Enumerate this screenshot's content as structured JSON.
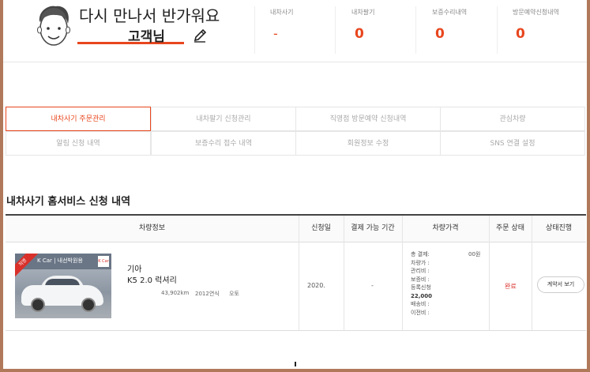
{
  "profile": {
    "greeting": "다시 만나서 반가워요",
    "customer_label": "고객님",
    "avatar_icon": "user-avatar-icon",
    "edit_icon": "pencil-icon"
  },
  "stats": [
    {
      "label": "내차사기",
      "value": "-"
    },
    {
      "label": "내차팔기",
      "value": "0"
    },
    {
      "label": "보증수리내역",
      "value": "0"
    },
    {
      "label": "방문예약신청내역",
      "value": "0"
    }
  ],
  "tabs": [
    {
      "label": "내차사기 주문관리",
      "active": true
    },
    {
      "label": "내차팔기 신청관리",
      "active": false
    },
    {
      "label": "직영점 방문예약 신청내역",
      "active": false
    },
    {
      "label": "관심차량",
      "active": false
    },
    {
      "label": "알림 신청 내역",
      "active": false
    },
    {
      "label": "보증수리 접수 내역",
      "active": false
    },
    {
      "label": "회원정보 수정",
      "active": false
    },
    {
      "label": "SNS 연결 설정",
      "active": false
    }
  ],
  "section_title": "내차사기 홈서비스 신청 내역",
  "table": {
    "headers": [
      "차량정보",
      "신청일",
      "결제 가능 기간",
      "차량가격",
      "주문 상태",
      "상태진행"
    ],
    "rows": [
      {
        "maker": "기아",
        "model": "K5 2.0 럭셔리",
        "mileage": "43,902km",
        "year": "2012연식",
        "transmission": "오토",
        "apply_date": "2020.",
        "pay_period": "-",
        "price_lines": [
          "총 결제:",
          "차량가 :",
          "관리비 :",
          "보증비 :",
          "등록신청",
          "22,000",
          "배송비 :",
          "이전비 :"
        ],
        "price_total": "00원",
        "order_status": "완료",
        "action_label": "계약서 보기",
        "image_band_text": "K Car | 내선박원용",
        "image_ribbon": "직영",
        "image_badge": "K Car"
      }
    ]
  },
  "colors": {
    "accent": "#e8461e",
    "status_done": "#d9302a",
    "frame": "#b07a5a"
  }
}
